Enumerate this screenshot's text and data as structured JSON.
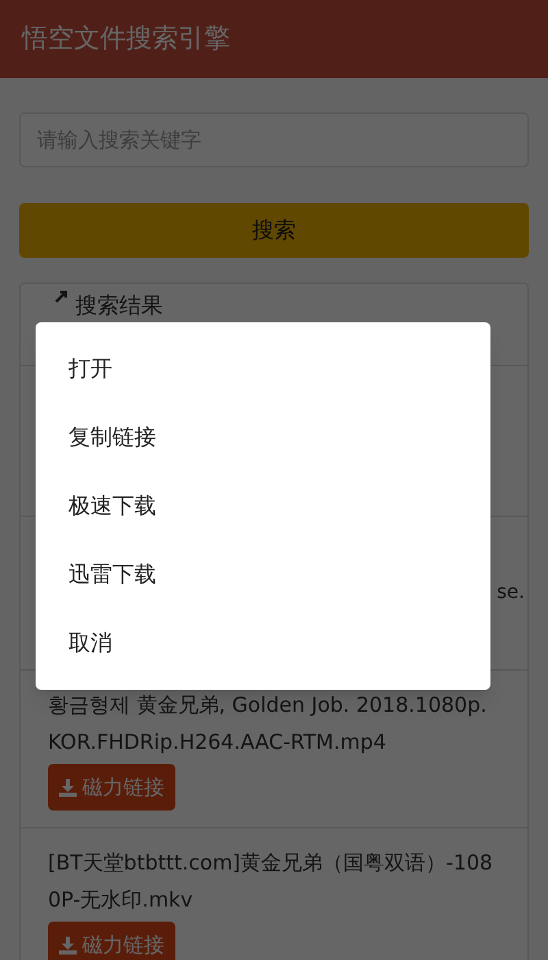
{
  "app_bar": {
    "title": "悟空文件搜索引擎"
  },
  "search": {
    "placeholder": "请输入搜索关键字",
    "button": "搜索"
  },
  "results": {
    "header": "搜索结果",
    "hidden_fragment": "se.",
    "items": [
      {
        "name": "황금형제 黄金兄弟, Golden Job. 2018.1080p.KOR.FHDRip.H264.AAC-RTM.mp4",
        "button": "磁力链接"
      },
      {
        "name": "[BT天堂btbttt.com]黄金兄弟（国粤双语）-1080P-无水印.mkv",
        "button": "磁力链接"
      }
    ]
  },
  "dialog": {
    "items": [
      "打开",
      "复制链接",
      "极速下载",
      "迅雷下载",
      "取消"
    ]
  }
}
